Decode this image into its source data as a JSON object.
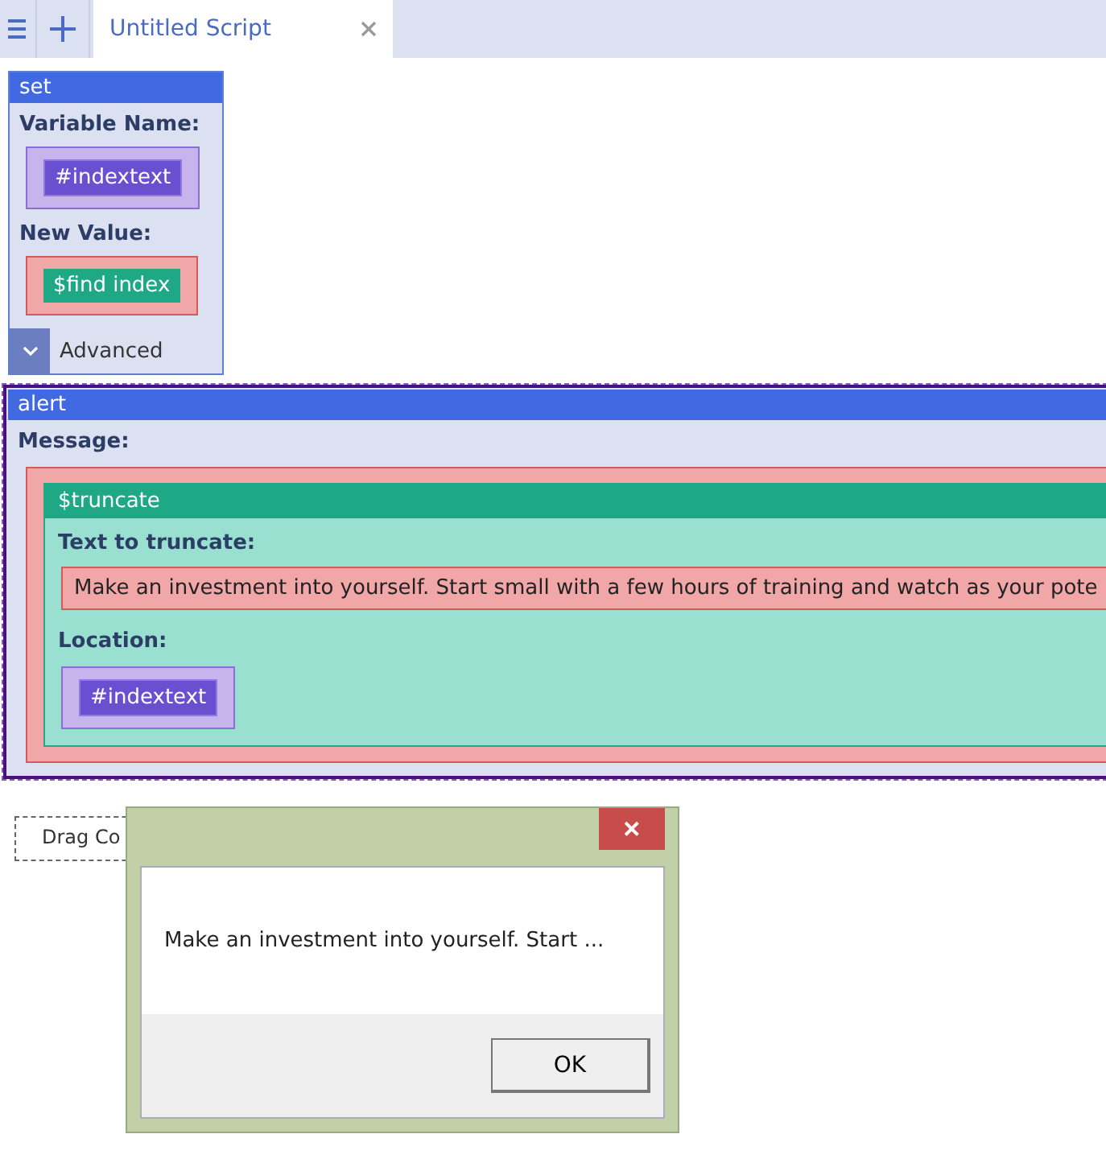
{
  "tabs": [
    {
      "label": "Untitled Script",
      "selected": true
    }
  ],
  "set_block": {
    "title": "set",
    "fields": [
      {
        "label": "Variable Name:",
        "kind": "variable",
        "value": "#indextext"
      },
      {
        "label": "New Value:",
        "kind": "function",
        "value": "$find index"
      }
    ],
    "advanced": {
      "label": "Advanced",
      "expanded": false
    }
  },
  "alert_block": {
    "title": "alert",
    "field_label": "Message:",
    "function": {
      "title": "$truncate",
      "fields": [
        {
          "label": "Text to truncate:",
          "kind": "text",
          "value": "Make an investment into yourself. Start small with a few hours of training and watch as your pote"
        },
        {
          "label": "Location:",
          "kind": "variable",
          "value": "#indextext"
        }
      ]
    }
  },
  "drop_target": {
    "label": "Drag Co"
  },
  "dialog": {
    "message": "Make an investment into yourself. Start ...",
    "buttons": [
      "OK"
    ],
    "close": "✕"
  }
}
